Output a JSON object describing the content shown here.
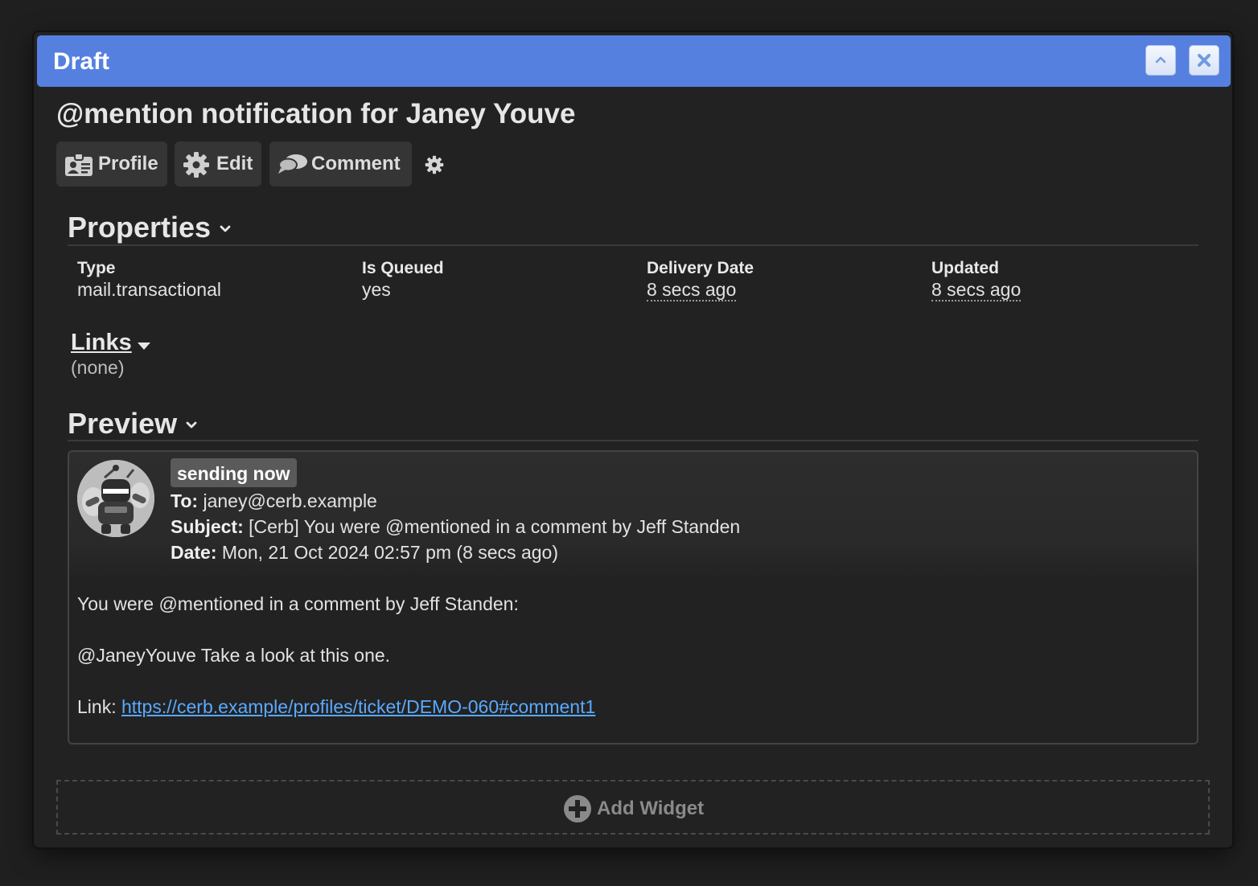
{
  "window": {
    "title": "Draft"
  },
  "record": {
    "title": "@mention notification for Janey Youve"
  },
  "toolbar": {
    "profile_label": "Profile",
    "edit_label": "Edit",
    "comment_label": "Comment"
  },
  "properties": {
    "heading": "Properties",
    "items": [
      {
        "label": "Type",
        "value": "mail.transactional"
      },
      {
        "label": "Is Queued",
        "value": "yes"
      },
      {
        "label": "Delivery Date",
        "value": "8 secs ago"
      },
      {
        "label": "Updated",
        "value": "8 secs ago"
      }
    ]
  },
  "links": {
    "heading": "Links",
    "empty": "(none)"
  },
  "preview": {
    "heading": "Preview",
    "status_badge": "sending now",
    "to_label": "To:",
    "to_value": "janey@cerb.example",
    "subject_label": "Subject:",
    "subject_value": "[Cerb] You were @mentioned in a comment by Jeff Standen",
    "date_label": "Date:",
    "date_value": "Mon, 21 Oct 2024 02:57 pm (8 secs ago)",
    "body_line1": "You were @mentioned in a comment by Jeff Standen:",
    "body_line2": "@JaneyYouve Take a look at this one.",
    "link_label": "Link:",
    "link_url": "https://cerb.example/profiles/ticket/DEMO-060#comment1"
  },
  "add_widget": {
    "label": "Add Widget"
  },
  "colors": {
    "titlebar": "#5580e0",
    "background": "#222222",
    "link": "#5aa9ff",
    "badge": "#5a5a5a"
  }
}
